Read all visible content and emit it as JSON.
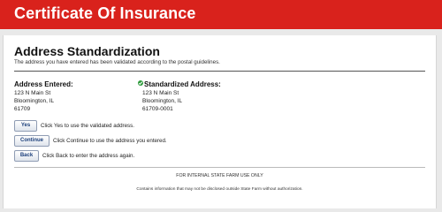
{
  "header": {
    "title": "Certificate Of Insurance"
  },
  "page": {
    "title": "Address Standardization",
    "subtitle": "The address you have entered has been validated according to the postal guidelines."
  },
  "address_entered": {
    "heading": "Address Entered:",
    "line1": "123 N Main St",
    "line2": "Bloomington, IL",
    "line3": "61709"
  },
  "address_standardized": {
    "heading": "Standardized Address:",
    "icon": "check-circle-icon",
    "line1": "123 N Main St",
    "line2": "Bloomington, IL",
    "line3": "61709-0001"
  },
  "actions": {
    "yes_label": "Yes",
    "yes_text": "Click Yes to use the validated address.",
    "continue_label": "Continue",
    "continue_text": "Click Continue to use the address you entered.",
    "back_label": "Back",
    "back_text": "Click Back to enter the address again."
  },
  "footer": {
    "line1": "FOR INTERNAL STATE FARM USE ONLY",
    "line2": "Contains information that may not be disclosed outside State Farm without authorization."
  },
  "colors": {
    "header_bg": "#d9221c",
    "button_text": "#1a3e7a",
    "check": "#2c9a3a"
  }
}
